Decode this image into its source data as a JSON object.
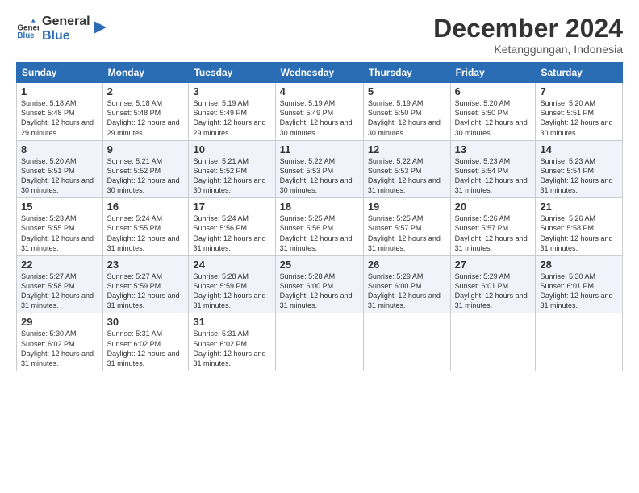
{
  "logo": {
    "general": "General",
    "blue": "Blue"
  },
  "title": "December 2024",
  "subtitle": "Ketanggungan, Indonesia",
  "days_of_week": [
    "Sunday",
    "Monday",
    "Tuesday",
    "Wednesday",
    "Thursday",
    "Friday",
    "Saturday"
  ],
  "weeks": [
    [
      {
        "day": "1",
        "sunrise": "5:18 AM",
        "sunset": "5:48 PM",
        "daylight": "12 hours and 29 minutes."
      },
      {
        "day": "2",
        "sunrise": "5:18 AM",
        "sunset": "5:48 PM",
        "daylight": "12 hours and 29 minutes."
      },
      {
        "day": "3",
        "sunrise": "5:19 AM",
        "sunset": "5:49 PM",
        "daylight": "12 hours and 29 minutes."
      },
      {
        "day": "4",
        "sunrise": "5:19 AM",
        "sunset": "5:49 PM",
        "daylight": "12 hours and 30 minutes."
      },
      {
        "day": "5",
        "sunrise": "5:19 AM",
        "sunset": "5:50 PM",
        "daylight": "12 hours and 30 minutes."
      },
      {
        "day": "6",
        "sunrise": "5:20 AM",
        "sunset": "5:50 PM",
        "daylight": "12 hours and 30 minutes."
      },
      {
        "day": "7",
        "sunrise": "5:20 AM",
        "sunset": "5:51 PM",
        "daylight": "12 hours and 30 minutes."
      }
    ],
    [
      {
        "day": "8",
        "sunrise": "5:20 AM",
        "sunset": "5:51 PM",
        "daylight": "12 hours and 30 minutes."
      },
      {
        "day": "9",
        "sunrise": "5:21 AM",
        "sunset": "5:52 PM",
        "daylight": "12 hours and 30 minutes."
      },
      {
        "day": "10",
        "sunrise": "5:21 AM",
        "sunset": "5:52 PM",
        "daylight": "12 hours and 30 minutes."
      },
      {
        "day": "11",
        "sunrise": "5:22 AM",
        "sunset": "5:53 PM",
        "daylight": "12 hours and 30 minutes."
      },
      {
        "day": "12",
        "sunrise": "5:22 AM",
        "sunset": "5:53 PM",
        "daylight": "12 hours and 31 minutes."
      },
      {
        "day": "13",
        "sunrise": "5:23 AM",
        "sunset": "5:54 PM",
        "daylight": "12 hours and 31 minutes."
      },
      {
        "day": "14",
        "sunrise": "5:23 AM",
        "sunset": "5:54 PM",
        "daylight": "12 hours and 31 minutes."
      }
    ],
    [
      {
        "day": "15",
        "sunrise": "5:23 AM",
        "sunset": "5:55 PM",
        "daylight": "12 hours and 31 minutes."
      },
      {
        "day": "16",
        "sunrise": "5:24 AM",
        "sunset": "5:55 PM",
        "daylight": "12 hours and 31 minutes."
      },
      {
        "day": "17",
        "sunrise": "5:24 AM",
        "sunset": "5:56 PM",
        "daylight": "12 hours and 31 minutes."
      },
      {
        "day": "18",
        "sunrise": "5:25 AM",
        "sunset": "5:56 PM",
        "daylight": "12 hours and 31 minutes."
      },
      {
        "day": "19",
        "sunrise": "5:25 AM",
        "sunset": "5:57 PM",
        "daylight": "12 hours and 31 minutes."
      },
      {
        "day": "20",
        "sunrise": "5:26 AM",
        "sunset": "5:57 PM",
        "daylight": "12 hours and 31 minutes."
      },
      {
        "day": "21",
        "sunrise": "5:26 AM",
        "sunset": "5:58 PM",
        "daylight": "12 hours and 31 minutes."
      }
    ],
    [
      {
        "day": "22",
        "sunrise": "5:27 AM",
        "sunset": "5:58 PM",
        "daylight": "12 hours and 31 minutes."
      },
      {
        "day": "23",
        "sunrise": "5:27 AM",
        "sunset": "5:59 PM",
        "daylight": "12 hours and 31 minutes."
      },
      {
        "day": "24",
        "sunrise": "5:28 AM",
        "sunset": "5:59 PM",
        "daylight": "12 hours and 31 minutes."
      },
      {
        "day": "25",
        "sunrise": "5:28 AM",
        "sunset": "6:00 PM",
        "daylight": "12 hours and 31 minutes."
      },
      {
        "day": "26",
        "sunrise": "5:29 AM",
        "sunset": "6:00 PM",
        "daylight": "12 hours and 31 minutes."
      },
      {
        "day": "27",
        "sunrise": "5:29 AM",
        "sunset": "6:01 PM",
        "daylight": "12 hours and 31 minutes."
      },
      {
        "day": "28",
        "sunrise": "5:30 AM",
        "sunset": "6:01 PM",
        "daylight": "12 hours and 31 minutes."
      }
    ],
    [
      {
        "day": "29",
        "sunrise": "5:30 AM",
        "sunset": "6:02 PM",
        "daylight": "12 hours and 31 minutes."
      },
      {
        "day": "30",
        "sunrise": "5:31 AM",
        "sunset": "6:02 PM",
        "daylight": "12 hours and 31 minutes."
      },
      {
        "day": "31",
        "sunrise": "5:31 AM",
        "sunset": "6:02 PM",
        "daylight": "12 hours and 31 minutes."
      },
      null,
      null,
      null,
      null
    ]
  ],
  "labels": {
    "sunrise": "Sunrise:",
    "sunset": "Sunset:",
    "daylight": "Daylight:"
  }
}
